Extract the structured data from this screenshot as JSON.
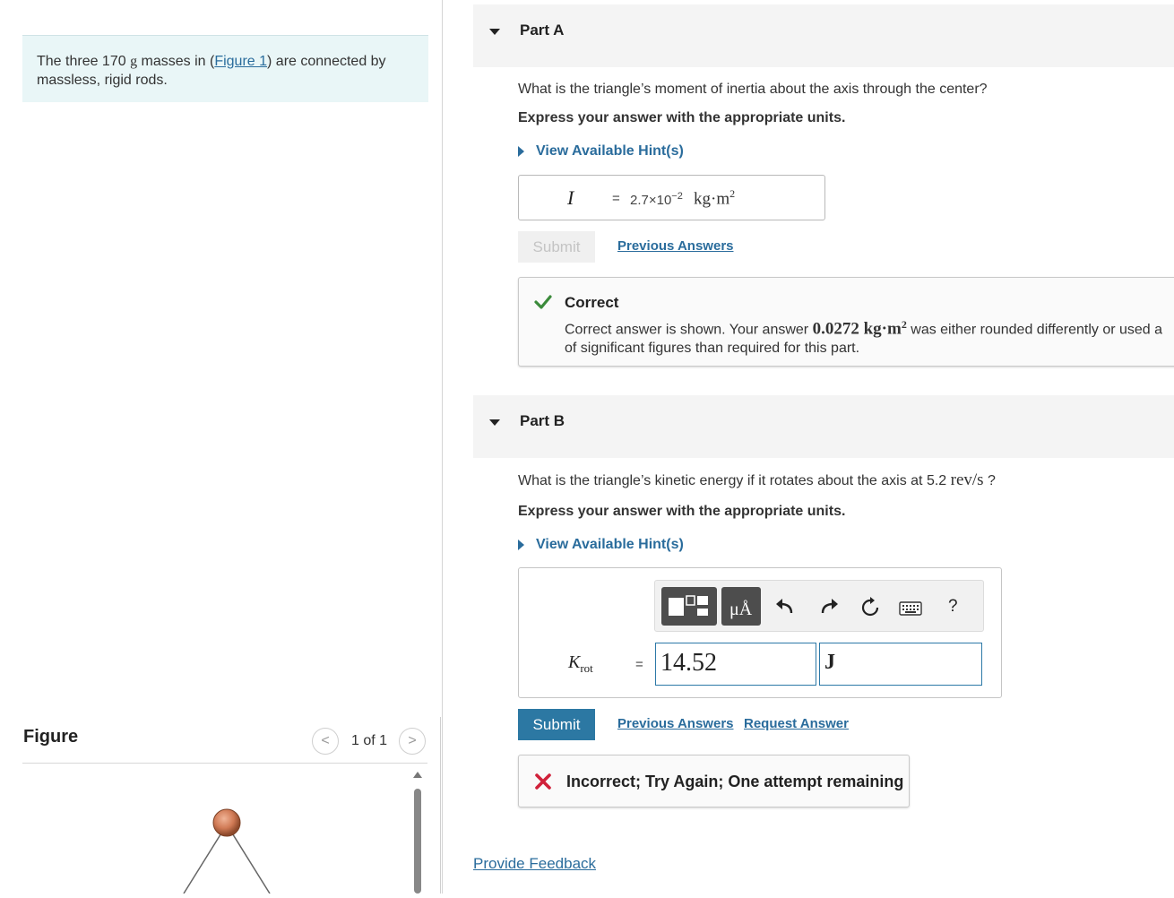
{
  "intro": {
    "before": "The three 170 ",
    "unit_g": "g",
    "mid": " masses in (",
    "figure_link": "Figure 1",
    "after": ") are connected by massless, rigid rods."
  },
  "figure": {
    "title": "Figure",
    "prev": "<",
    "next": ">",
    "pager": "1 of 1"
  },
  "part_a": {
    "title": "Part A",
    "question": "What is the triangle’s moment of inertia about the axis through the center?",
    "instruction": "Express your answer with the appropriate units.",
    "hint": "View Available Hint(s)",
    "answer": {
      "variable": "I",
      "equals": "=",
      "value": "2.7×10",
      "exponent": "−2",
      "unit_main": "kg·m",
      "unit_exp": "2"
    },
    "submit": "Submit",
    "previous_answers": "Previous Answers",
    "feedback": {
      "status": "Correct",
      "msg_before": "Correct answer is shown. Your answer ",
      "msg_value": "0.0272 kg·m",
      "msg_exp": "2",
      "msg_after": " was either rounded differently or used a",
      "msg_line2": "of significant figures than required for this part."
    }
  },
  "part_b": {
    "title": "Part B",
    "question_before": "What is the triangle’s kinetic energy if it rotates about the axis at 5.2 ",
    "question_unit": "rev/s",
    "question_after": " ?",
    "instruction": "Express your answer with the appropriate units.",
    "hint": "View Available Hint(s)",
    "toolbar": {
      "units_label": "μÅ",
      "help": "?",
      "icons": [
        "templates-icon",
        "units-icon",
        "undo-icon",
        "redo-icon",
        "reset-icon",
        "keyboard-icon",
        "help-icon"
      ]
    },
    "answer": {
      "variable": "K",
      "subscript": "rot",
      "equals": "=",
      "value": "14.52",
      "unit": "J"
    },
    "submit": "Submit",
    "previous_answers": "Previous Answers",
    "request_answer": "Request Answer",
    "feedback": {
      "status": "Incorrect; Try Again; One attempt remaining"
    }
  },
  "provide_feedback": "Provide Feedback",
  "colors": {
    "link": "#2a6c9c",
    "primary_button": "#2c78a3",
    "correct_check": "#3b8b3b",
    "incorrect_x": "#d0213a",
    "intro_bg": "#e9f6f7"
  }
}
